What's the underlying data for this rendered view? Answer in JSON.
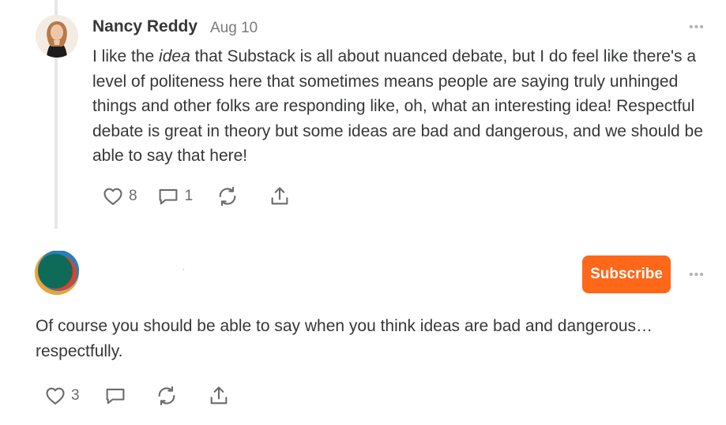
{
  "comment1": {
    "author": "Nancy Reddy",
    "date": "Aug 10",
    "body_before": "I like the ",
    "body_emphasis": "idea",
    "body_after": " that Substack is all about nuanced debate, but I do feel like there's a level of politeness here that sometimes means people are saying truly unhinged things and other folks are responding like, oh, what an interesting idea! Respectful debate is great in theory but some ideas are bad and dangerous, and we should be able to say that here!",
    "like_count": "8",
    "reply_count": "1",
    "more_label": "•••"
  },
  "comment2": {
    "subscribe_label": "Subscribe",
    "body": "Of course you should be able to say when you think ideas are bad and dangerous… respectfully.",
    "like_count": "3",
    "more_label": "•••"
  },
  "colors": {
    "accent": "#ff6719",
    "text": "#363737",
    "muted": "#7a7a7a"
  },
  "icons": [
    "heart-icon",
    "comment-icon",
    "restack-icon",
    "share-icon",
    "more-icon"
  ]
}
